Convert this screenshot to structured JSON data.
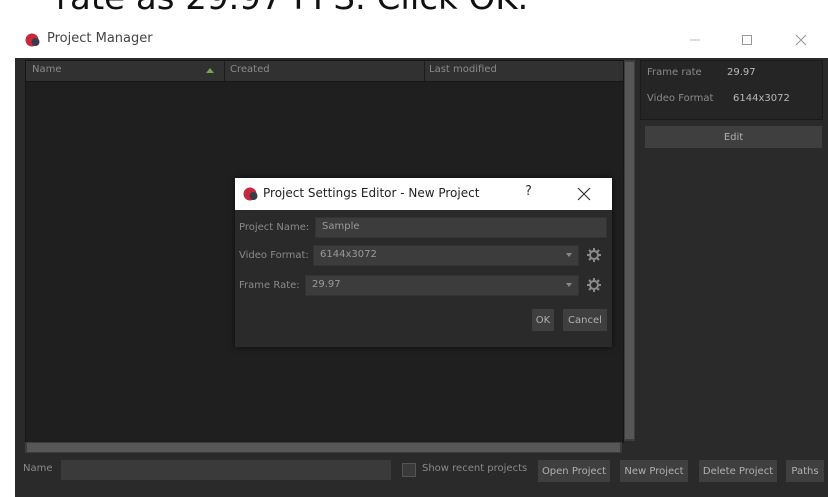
{
  "caption": "rate as 29.97 FPS. Click OK.",
  "window": {
    "title": "Project Manager"
  },
  "list": {
    "columns": [
      "Name",
      "Created",
      "Last modified"
    ]
  },
  "info": {
    "frame_rate_label": "Frame rate",
    "frame_rate_value": "29.97",
    "video_format_label": "Video Format",
    "video_format_value": "6144x3072",
    "edit_label": "Edit"
  },
  "bottom": {
    "name_label": "Name",
    "name_value": "",
    "show_recent_label": "Show recent projects",
    "open_project_label": "Open Project",
    "new_project_label": "New Project",
    "delete_project_label": "Delete Project",
    "paths_label": "Paths"
  },
  "dialog": {
    "title": "Project Settings Editor - New Project",
    "help_label": "?",
    "project_name_label": "Project Name:",
    "project_name_value": "Sample",
    "video_format_label": "Video Format:",
    "video_format_value": "6144x3072",
    "frame_rate_label": "Frame Rate:",
    "frame_rate_value": "29.97",
    "ok_label": "OK",
    "cancel_label": "Cancel"
  },
  "colors": {
    "accent_red": "#c8283c",
    "sort_arrow": "#6fa84f"
  },
  "icons": [
    "app-logo-icon",
    "minimize-icon",
    "maximize-icon",
    "close-icon",
    "sort-ascending-icon",
    "gear-icon",
    "help-icon"
  ]
}
